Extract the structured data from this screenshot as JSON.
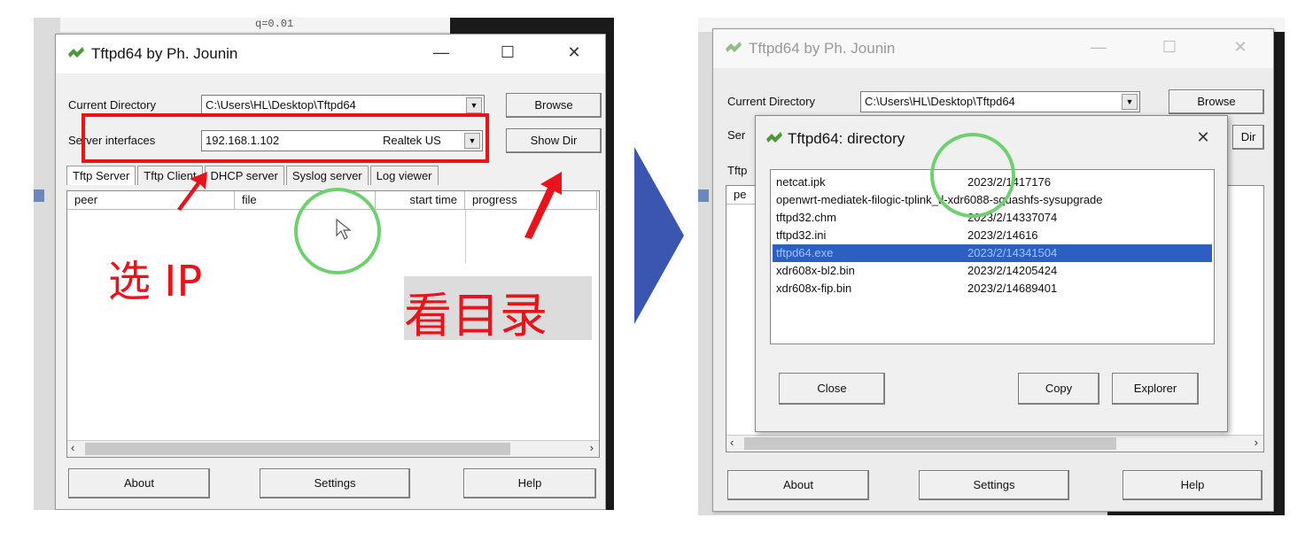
{
  "left": {
    "code_snippet": "q=0.01",
    "window_title": "Tftpd64 by Ph. Jounin",
    "current_directory_label": "Current Directory",
    "current_directory_value": "C:\\Users\\HL\\Desktop\\Tftpd64",
    "browse_label": "Browse",
    "server_interfaces_label": "Server interfaces",
    "server_interfaces_value": "192.168.1.102",
    "adapter_value": "Realtek US",
    "show_dir_label": "Show Dir",
    "tabs": [
      "Tftp Server",
      "Tftp Client",
      "DHCP server",
      "Syslog server",
      "Log viewer"
    ],
    "columns": [
      "peer",
      "file",
      "start time",
      "progress"
    ],
    "about_label": "About",
    "settings_label": "Settings",
    "help_label": "Help",
    "annotation_ip": "选 IP",
    "annotation_dir": "看目录"
  },
  "right": {
    "window_title": "Tftpd64 by Ph. Jounin",
    "current_directory_label": "Current Directory",
    "current_directory_value": "C:\\Users\\HL\\Desktop\\Tftpd64",
    "browse_label": "Browse",
    "server_label_partial": "Ser",
    "dir_button_partial": "Dir",
    "tab_partial": "Tftp",
    "col_partial": "pe",
    "dialog_title": "Tftpd64: directory",
    "files": [
      {
        "name": "netcat.ipk",
        "info": "2023/2/1417176"
      },
      {
        "name": "openwrt-mediatek-filogic-tplink_tl-xdr6088-squashfs-sysupgrade",
        "info": ""
      },
      {
        "name": "tftpd32.chm",
        "info": "2023/2/14337074"
      },
      {
        "name": "tftpd32.ini",
        "info": "2023/2/14616"
      },
      {
        "name": "tftpd64.exe",
        "info": "2023/2/14341504"
      },
      {
        "name": "xdr608x-bl2.bin",
        "info": "2023/2/14205424"
      },
      {
        "name": "xdr608x-fip.bin",
        "info": "2023/2/14689401"
      }
    ],
    "selected_file_index": 4,
    "close_label": "Close",
    "copy_label": "Copy",
    "explorer_label": "Explorer",
    "about_label": "About",
    "settings_label": "Settings",
    "help_label": "Help"
  },
  "colors": {
    "annotation_red": "#e8131b",
    "arrow_blue": "#3a56b0",
    "selection_blue": "#2d5fc2",
    "cursor_circle_green": "#6fd06f"
  }
}
